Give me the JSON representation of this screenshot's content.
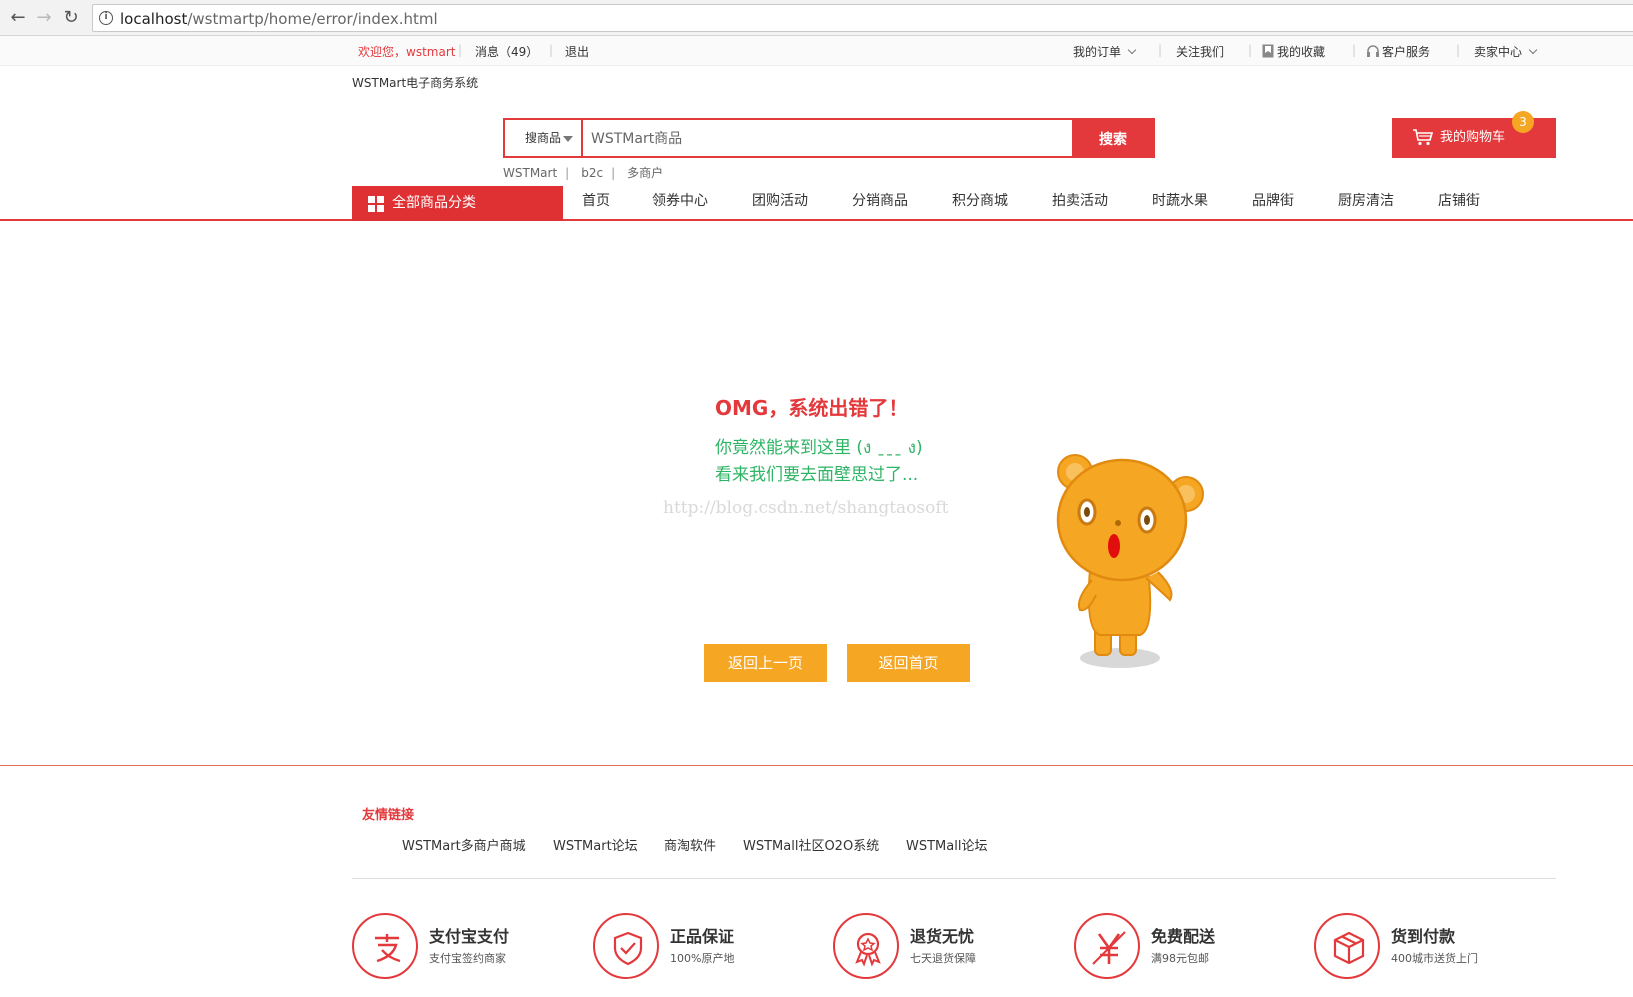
{
  "browser": {
    "url_host": "localhost",
    "url_path": "/wstmartp/home/error/index.html"
  },
  "topbar": {
    "welcome": "欢迎您，wstmart",
    "messages": "消息（49）",
    "logout": "退出",
    "my_orders": "我的订单",
    "follow_us": "关注我们",
    "favorites": "我的收藏",
    "customer_service": "客户服务",
    "seller_center": "卖家中心"
  },
  "header": {
    "site_name": "WSTMart电子商务系统",
    "search_type": "搜商品",
    "search_value": "WSTMart商品",
    "search_button": "搜索",
    "hot_words": [
      "WSTMart",
      "b2c",
      "多商户"
    ],
    "cart_label": "我的购物车",
    "cart_count": "3"
  },
  "nav": {
    "categories_label": "全部商品分类",
    "items": [
      "首页",
      "领券中心",
      "团购活动",
      "分销商品",
      "积分商城",
      "拍卖活动",
      "时蔬水果",
      "品牌街",
      "厨房清洁",
      "店铺街"
    ]
  },
  "error": {
    "title": "OMG，系统出错了！",
    "line1": "你竟然能来到这里 (ง ˍˍˍ ง)",
    "line2": "看来我们要去面壁思过了...",
    "watermark": "http://blog.csdn.net/shangtaosoft",
    "back_button": "返回上一页",
    "home_button": "返回首页"
  },
  "footer": {
    "links_title": "友情链接",
    "links": [
      "WSTMart多商户商城",
      "WSTMart论坛",
      "商淘软件",
      "WSTMall社区O2O系统",
      "WSTMall论坛"
    ],
    "features": [
      {
        "title": "支付宝支付",
        "sub": "支付宝签约商家",
        "icon": "alipay-icon"
      },
      {
        "title": "正品保证",
        "sub": "100%原产地",
        "icon": "shield-check-icon"
      },
      {
        "title": "退货无忧",
        "sub": "七天退货保障",
        "icon": "award-ribbon-icon"
      },
      {
        "title": "免费配送",
        "sub": "满98元包邮",
        "icon": "yen-icon"
      },
      {
        "title": "货到付款",
        "sub": "400城市送货上门",
        "icon": "box-icon"
      }
    ]
  },
  "colors": {
    "accent_red": "#e3393c",
    "button_orange": "#f5a623",
    "message_green": "#2db565"
  }
}
